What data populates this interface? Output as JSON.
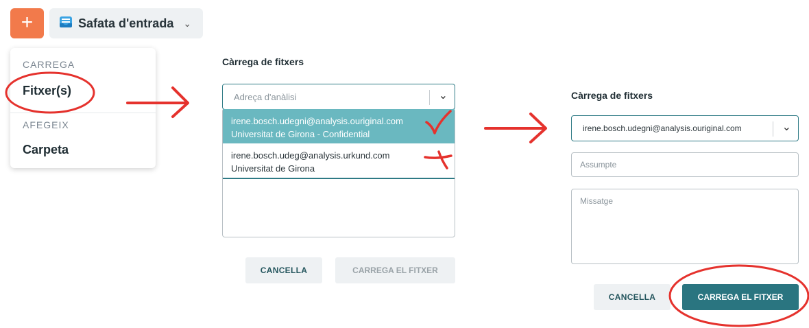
{
  "topbar": {
    "plus_label": "+",
    "inbox_label": "Safata d'entrada",
    "inbox_icon": "inbox-icon",
    "chevron_icon": "chevron-down-icon"
  },
  "menu": {
    "section_upload": "CARREGA",
    "item_files": "Fitxer(s)",
    "section_add": "AFEGEIX",
    "item_folder": "Carpeta"
  },
  "panel2": {
    "title": "Càrrega de fitxers",
    "select_placeholder": "Adreça d'anàlisi",
    "options": [
      {
        "email": "irene.bosch.udegni@analysis.ouriginal.com",
        "org": "Universitat de Girona - Confidential"
      },
      {
        "email": "irene.bosch.udeg@analysis.urkund.com",
        "org": "Universitat de Girona"
      }
    ],
    "cancel_label": "CANCELLA",
    "upload_label": "CARREGA EL FITXER"
  },
  "panel3": {
    "title": "Càrrega de fitxers",
    "selected_value": "irene.bosch.udegni@analysis.ouriginal.com",
    "subject_placeholder": "Assumpte",
    "message_placeholder": "Missatge",
    "cancel_label": "CANCELLA",
    "upload_label": "CARREGA EL FITXER"
  },
  "colors": {
    "accent_orange": "#f27a4b",
    "teal": "#2a7580",
    "highlight": "#6ab8c0",
    "annotation_red": "#e5322d"
  }
}
